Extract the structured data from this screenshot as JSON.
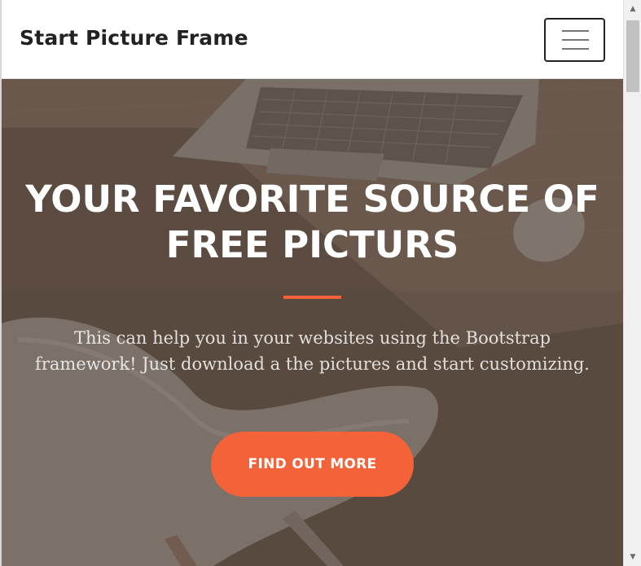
{
  "navbar": {
    "brand": "Start Picture Frame",
    "toggler_icon": "hamburger-menu-icon"
  },
  "masthead": {
    "heading": "YOUR FAVORITE SOURCE OF FREE PICTURS",
    "lead": "This can help you in your websites using the Bootstrap framework! Just download a the pictures and start customizing.",
    "cta_label": "FIND OUT MORE",
    "background_image": "laptop, mouse and chair on a wooden desk"
  },
  "scrollbar": {
    "up_icon": "chevron-up-icon",
    "down_icon": "chevron-down-icon"
  },
  "colors": {
    "accent": "#f4623a",
    "overlay": "#5c4d42",
    "navbar_bg": "#ffffff",
    "brand_text": "#222222"
  }
}
